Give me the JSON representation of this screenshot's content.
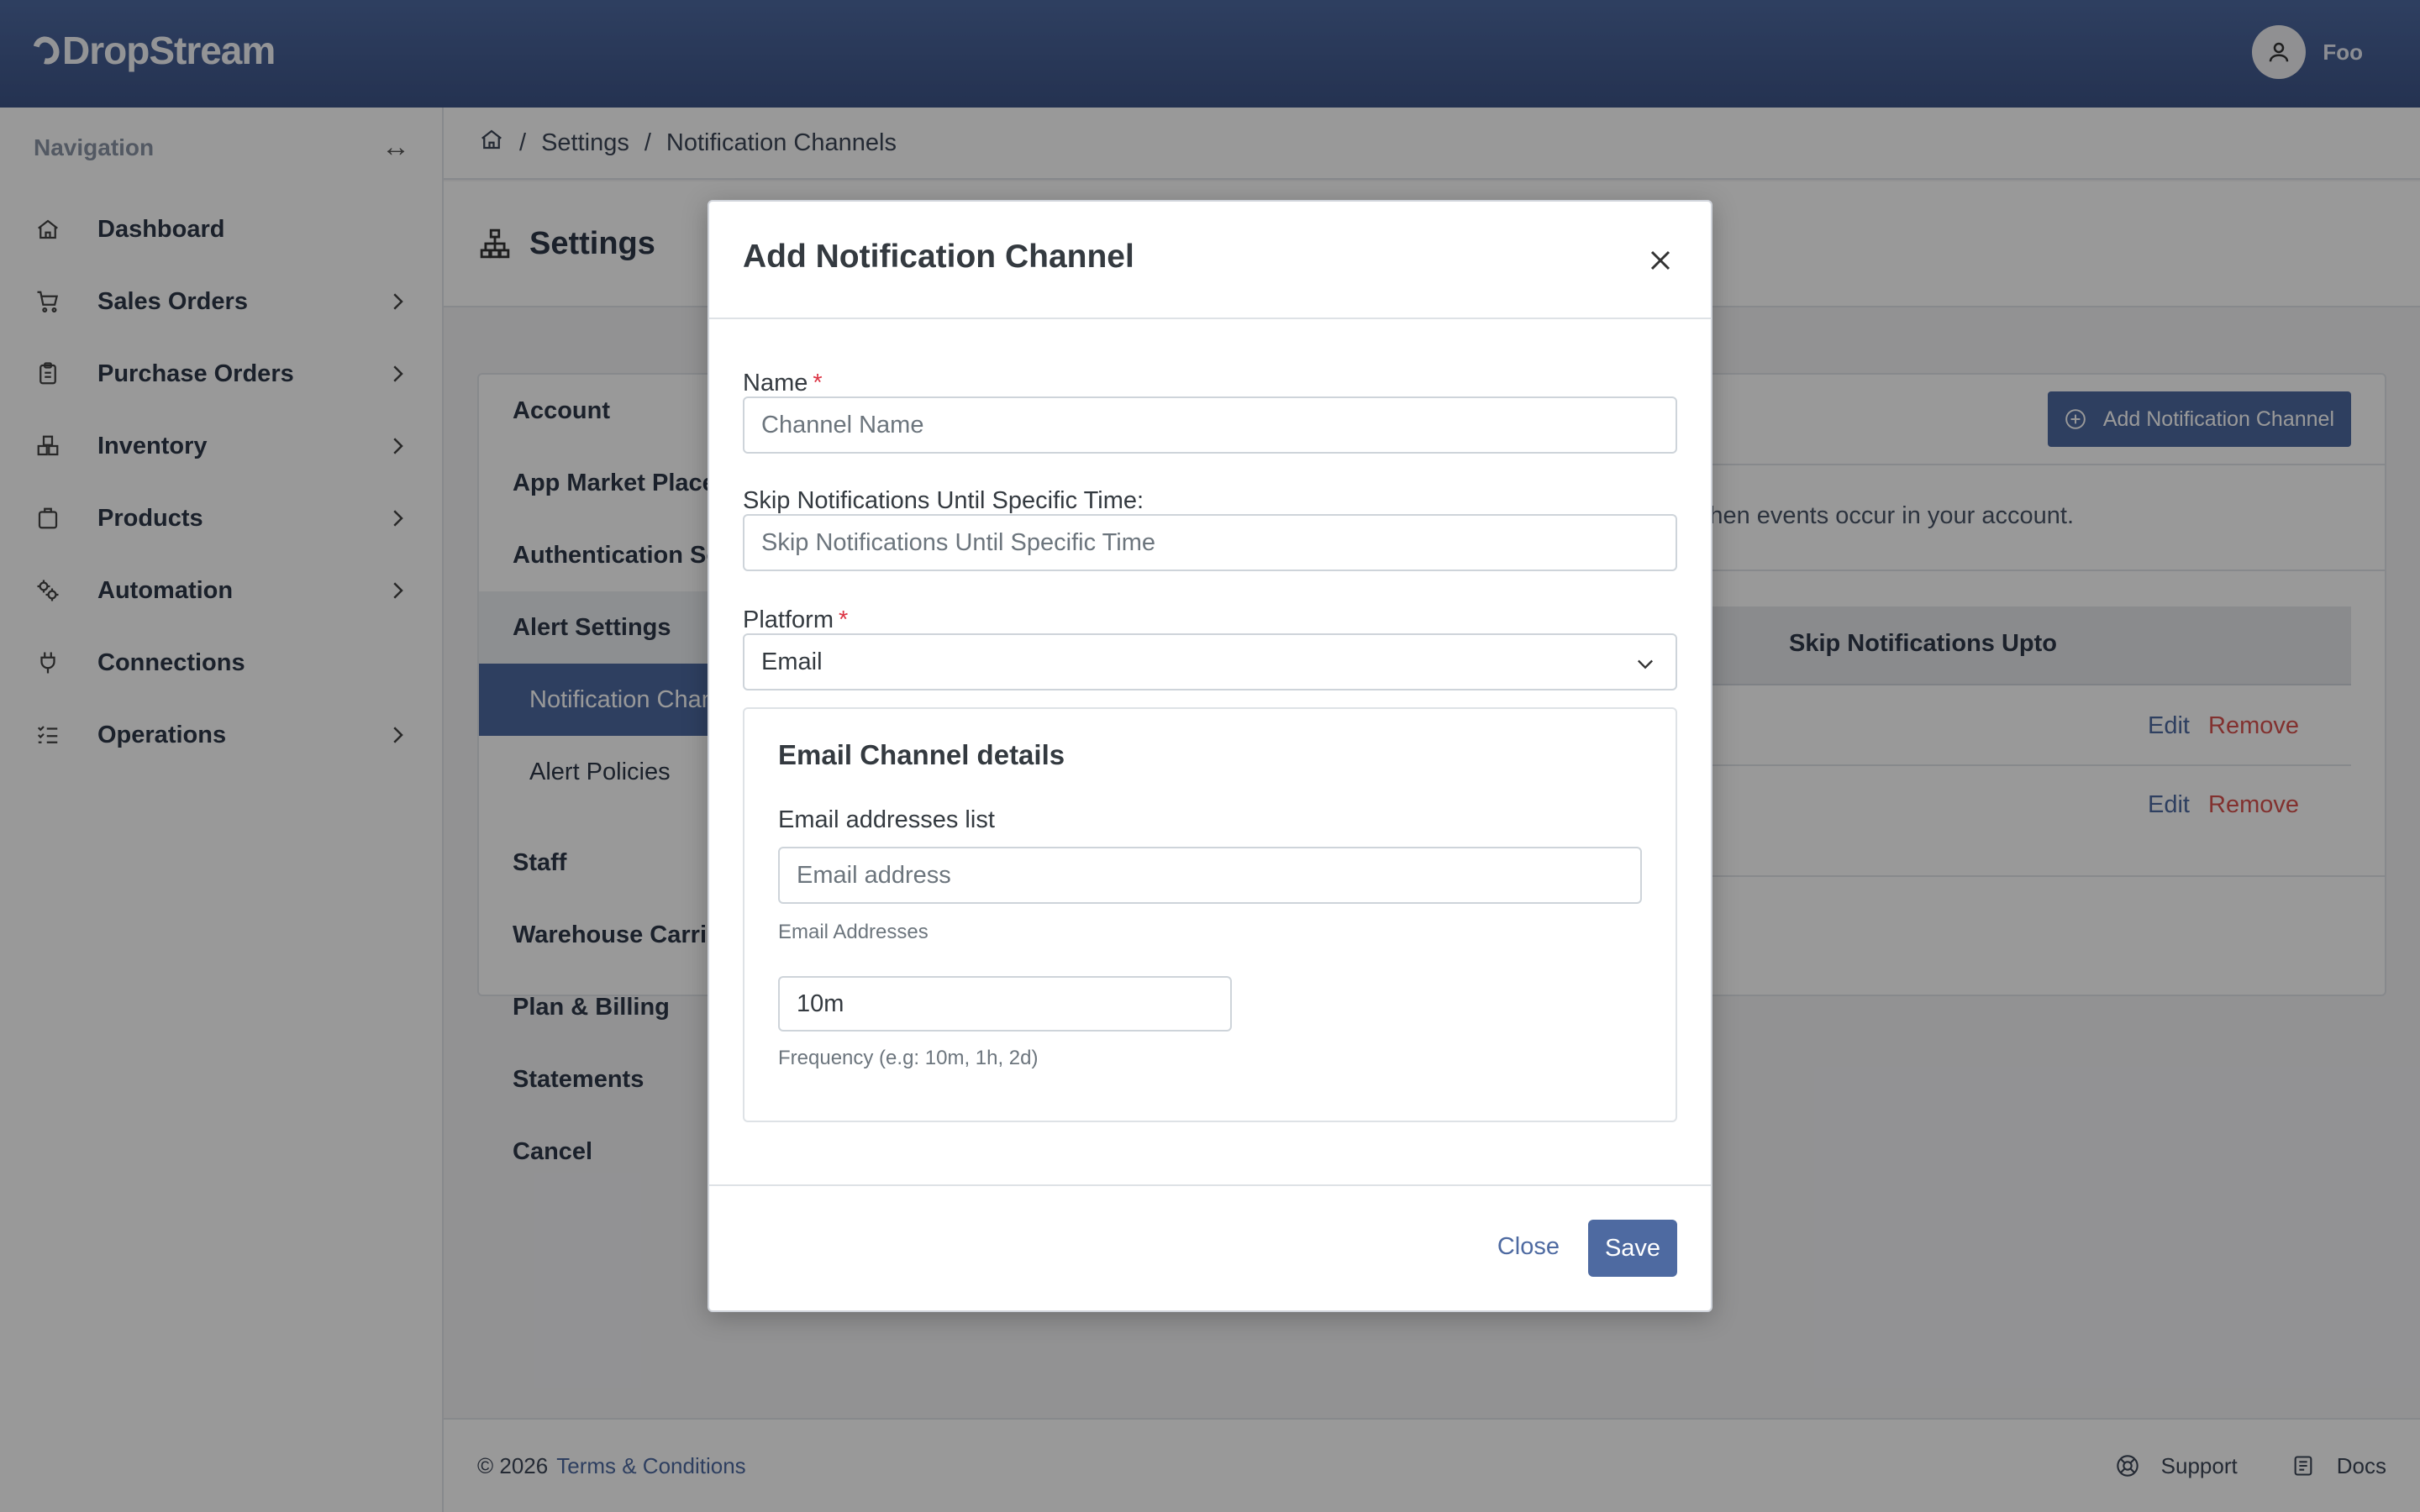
{
  "app": {
    "name": "DropStream",
    "user_name": "Foo"
  },
  "sidebar": {
    "title": "Navigation",
    "items": [
      {
        "label": "Dashboard",
        "icon": "home-icon",
        "has_children": false
      },
      {
        "label": "Sales Orders",
        "icon": "cart-icon",
        "has_children": true
      },
      {
        "label": "Purchase Orders",
        "icon": "clipboard-icon",
        "has_children": true
      },
      {
        "label": "Inventory",
        "icon": "boxes-icon",
        "has_children": true
      },
      {
        "label": "Products",
        "icon": "package-icon",
        "has_children": true
      },
      {
        "label": "Automation",
        "icon": "gears-icon",
        "has_children": true
      },
      {
        "label": "Connections",
        "icon": "plug-icon",
        "has_children": false
      },
      {
        "label": "Operations",
        "icon": "list-check-icon",
        "has_children": true
      }
    ]
  },
  "breadcrumb": {
    "items": [
      "Settings",
      "Notification Channels"
    ]
  },
  "page": {
    "title": "Settings"
  },
  "settings_menu": {
    "items": [
      "Account",
      "App Market Place",
      "Authentication So",
      "Alert Settings"
    ],
    "sub_items": [
      "Notification Chan",
      "Alert Policies"
    ],
    "items_after": [
      "Staff",
      "Warehouse Carrie",
      "Plan & Billing",
      "Statements",
      "Cancel"
    ]
  },
  "content": {
    "add_button": "Add Notification Channel",
    "description": "hen events occur in your account.",
    "table_header_skip": "Skip Notifications Upto",
    "rows": [
      {
        "edit": "Edit",
        "remove": "Remove"
      },
      {
        "edit": "Edit",
        "remove": "Remove"
      }
    ]
  },
  "footer": {
    "copyright": "© 2026",
    "terms": "Terms & Conditions",
    "support": "Support",
    "docs": "Docs"
  },
  "modal": {
    "title": "Add Notification Channel",
    "name_label": "Name",
    "name_placeholder": "Channel Name",
    "skip_label": "Skip Notifications Until Specific Time:",
    "skip_placeholder": "Skip Notifications Until Specific Time",
    "platform_label": "Platform",
    "platform_value": "Email",
    "email_section": {
      "title": "Email Channel details",
      "list_label": "Email addresses list",
      "address_placeholder": "Email address",
      "address_help": "Email Addresses",
      "frequency_value": "10m",
      "frequency_help": "Frequency (e.g: 10m, 1h, 2d)"
    },
    "close_label": "Close",
    "save_label": "Save"
  },
  "colors": {
    "brand": "#4e6aa1",
    "danger": "#d9534f",
    "required": "#dc3545"
  }
}
